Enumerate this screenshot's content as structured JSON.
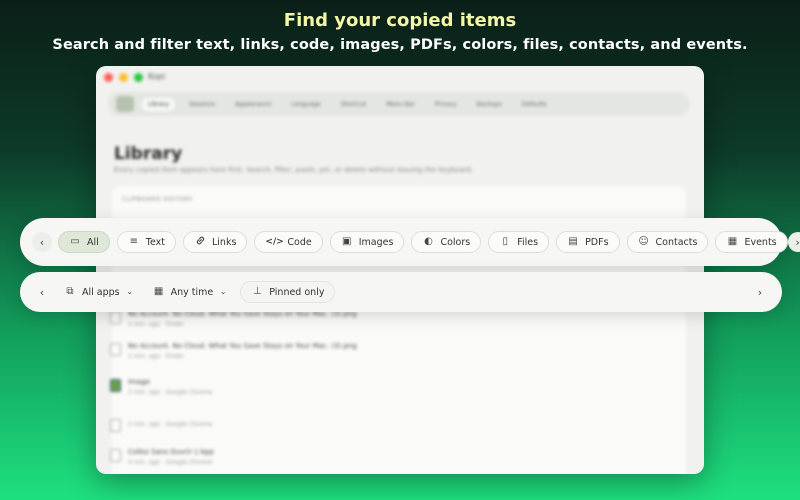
{
  "headline": "Find your copied items",
  "subheadline": "Search and filter text, links, code, images, PDFs, colors, files, contacts, and events.",
  "app": {
    "window_title": "Kopi",
    "toolbar": [
      "Library",
      "Sessions",
      "Appearance",
      "Language",
      "Shortcut",
      "Menu Bar",
      "Privacy",
      "Backups",
      "Defaults"
    ],
    "library_title": "Library",
    "library_description": "Every copied item appears here first. Search, filter, paste, pin, or delete without leaving the keyboard.",
    "history_label": "CLIPBOARD HISTORY",
    "items": [
      {
        "title": "No Account. No Cloud. What You Save Stays on Your Mac. (3).png",
        "meta": "2 min. ago · Finder"
      },
      {
        "title": "No Account. No Cloud. What You Save Stays on Your Mac. (3).png",
        "meta": "2 min. ago · Finder"
      },
      {
        "title": "Image",
        "meta": "2 min. ago · Google Chrome"
      },
      {
        "title": "",
        "meta": "2 min. ago · Google Chrome"
      },
      {
        "title": "Collez Sans Ouvrir L'App",
        "meta": "4 min. ago · Google Chrome"
      }
    ]
  },
  "type_filters": {
    "prev_icon": "chevron-left-icon",
    "next_icon": "chevron-right-icon",
    "chips": [
      {
        "label": "All",
        "icon": "tray-icon",
        "glyph": "▭",
        "active": true
      },
      {
        "label": "Text",
        "icon": "text-lines-icon",
        "glyph": "≡",
        "active": false
      },
      {
        "label": "Links",
        "icon": "link-icon",
        "glyph": "🔗",
        "active": false
      },
      {
        "label": "Code",
        "icon": "code-icon",
        "glyph": "</>",
        "active": false
      },
      {
        "label": "Images",
        "icon": "photo-icon",
        "glyph": "▣",
        "active": false
      },
      {
        "label": "Colors",
        "icon": "palette-icon",
        "glyph": "◐",
        "active": false
      },
      {
        "label": "Files",
        "icon": "document-icon",
        "glyph": "▯",
        "active": false
      },
      {
        "label": "PDFs",
        "icon": "pdf-icon",
        "glyph": "▤",
        "active": false
      },
      {
        "label": "Contacts",
        "icon": "contact-card-icon",
        "glyph": "☺",
        "active": false
      },
      {
        "label": "Events",
        "icon": "calendar-icon",
        "glyph": "▦",
        "active": false
      }
    ]
  },
  "scope_filters": {
    "apps_label": "All apps",
    "time_label": "Any time",
    "pinned_label": "Pinned only"
  },
  "colors": {
    "headline": "#f4f7a8",
    "active_chip": "#dfe8d8"
  }
}
